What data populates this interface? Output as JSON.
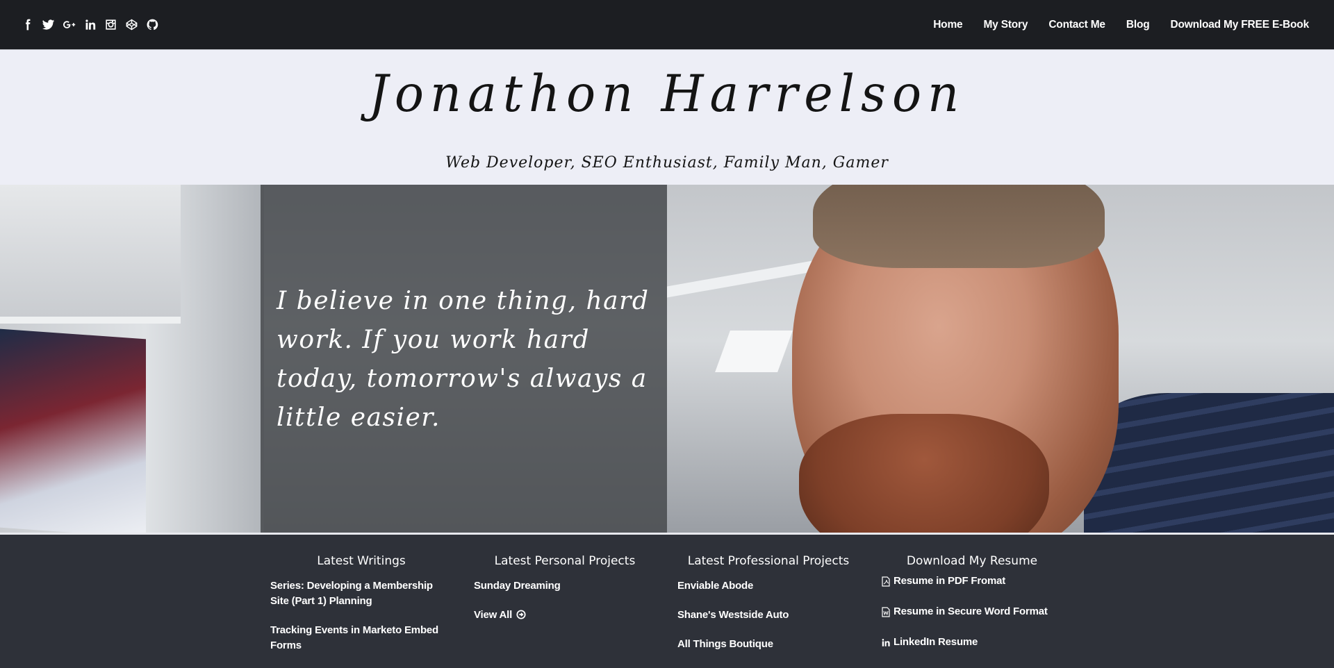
{
  "topbar": {
    "social": [
      {
        "name": "facebook-icon"
      },
      {
        "name": "twitter-icon"
      },
      {
        "name": "google-plus-icon"
      },
      {
        "name": "linkedin-icon"
      },
      {
        "name": "instagram-icon"
      },
      {
        "name": "codepen-icon"
      },
      {
        "name": "github-icon"
      }
    ],
    "nav": {
      "home": "Home",
      "story": "My Story",
      "contact": "Contact Me",
      "blog": "Blog",
      "ebook": "Download My FREE E-Book"
    }
  },
  "header": {
    "name": "Jonathon Harrelson",
    "tagline": "Web Developer, SEO Enthusiast, Family Man, Gamer"
  },
  "hero": {
    "quote": "I believe in one thing, hard work. If you work hard today, tomorrow's always a little easier."
  },
  "footer": {
    "writings": {
      "title": "Latest Writings",
      "items": [
        "Series: Developing a Membership Site (Part 1) Planning",
        "Tracking Events in Marketo Embed Forms"
      ]
    },
    "personal": {
      "title": "Latest Personal Projects",
      "items": [
        "Sunday Dreaming"
      ],
      "view_all": "View All"
    },
    "professional": {
      "title": "Latest Professional Projects",
      "items": [
        "Enviable Abode",
        "Shane's Westside Auto",
        "All Things Boutique"
      ]
    },
    "resume": {
      "title": "Download My Resume",
      "pdf": "Resume in PDF Fromat",
      "word": "Resume in Secure Word Format",
      "linkedin": "LinkedIn Resume"
    }
  },
  "colors": {
    "topbar_bg": "#1c1e22",
    "header_bg": "#edeef6",
    "footer_bg": "#2e3139"
  }
}
